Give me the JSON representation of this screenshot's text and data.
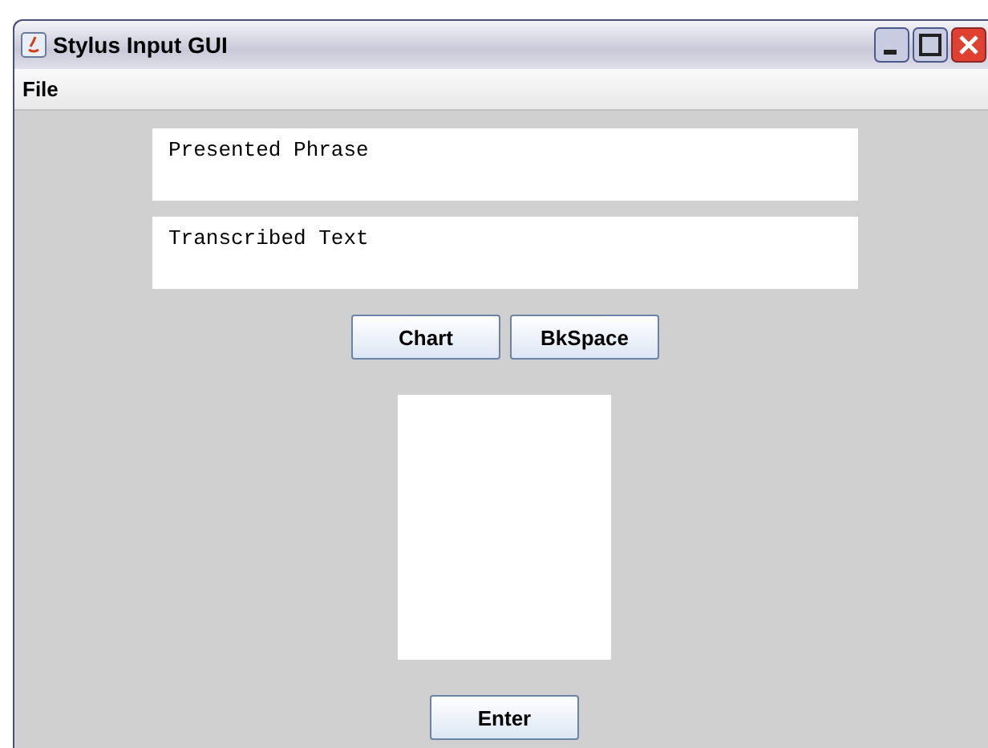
{
  "window": {
    "title": "Stylus Input GUI"
  },
  "menu": [
    "File"
  ],
  "fields": [
    {
      "value": "Presented Phrase"
    },
    {
      "value": "Transcribed Text"
    }
  ],
  "buttons": [
    "Chart",
    "BkSpace"
  ],
  "enter_button": "Enter"
}
